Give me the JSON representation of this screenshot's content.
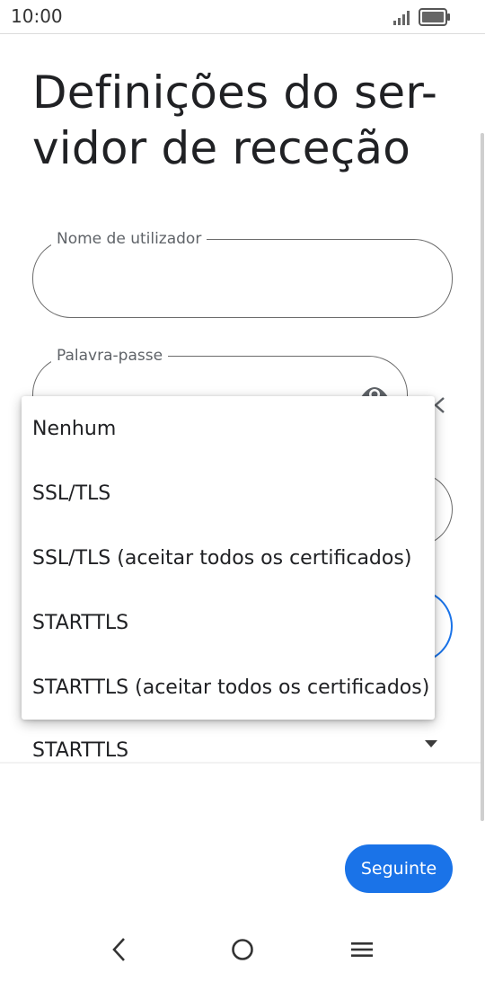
{
  "status_bar": {
    "time": "10:00"
  },
  "icons": {
    "signal": "signal-icon",
    "battery": "battery-icon",
    "eye": "eye-icon",
    "clear": "close-icon",
    "dropdown_arrow": "arrow-drop-down-icon",
    "back": "back-icon",
    "home": "home-icon",
    "menu": "menu-icon"
  },
  "page": {
    "title": "Definições do ser-vidor de receção"
  },
  "form": {
    "username_label": "Nome de utilizador",
    "username_value": "",
    "password_label": "Palavra-passe",
    "password_value": "",
    "security_selected": "STARTTLS"
  },
  "dropdown": {
    "options": [
      "Nenhum",
      "SSL/TLS",
      "SSL/TLS (aceitar todos os certificados)",
      "STARTTLS",
      "STARTTLS (aceitar todos os certificados)"
    ]
  },
  "actions": {
    "next_label": "Seguinte"
  },
  "colors": {
    "accent": "#1a73e8",
    "outline": "#6b6b6b",
    "label": "#5f6368"
  }
}
